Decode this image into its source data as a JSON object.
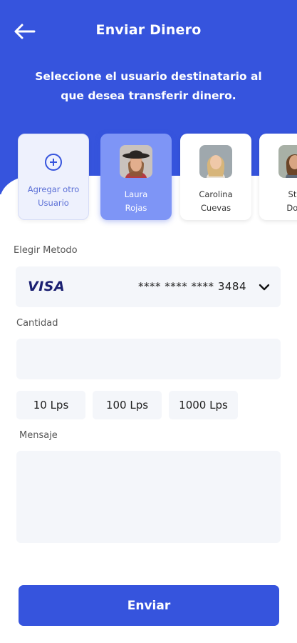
{
  "header": {
    "title": "Enviar Dinero",
    "subtitle": "Seleccione el usuario destinatario al que desea transferir dinero.",
    "back_icon": "arrow-left-icon",
    "accent_color": "#3654DD"
  },
  "recipients": {
    "add": {
      "line1": "Agregar otro",
      "line2": "Usuario",
      "icon": "plus-circle-icon"
    },
    "users": [
      {
        "first": "Laura",
        "last": "Rojas",
        "selected": true
      },
      {
        "first": "Carolina",
        "last": "Cuevas",
        "selected": false
      },
      {
        "first": "Ste",
        "last": "Don",
        "selected": false
      }
    ]
  },
  "method": {
    "label": "Elegir Metodo",
    "brand": "VISA",
    "card_number": "**** **** **** 3484",
    "chevron_icon": "chevron-down-icon"
  },
  "amount": {
    "label": "Cantidad",
    "value": "",
    "placeholder": ""
  },
  "quick_amounts": [
    "10 Lps",
    "100 Lps",
    "1000 Lps"
  ],
  "message": {
    "label": "Mensaje",
    "value": "",
    "placeholder": ""
  },
  "submit": {
    "label": "Enviar"
  }
}
